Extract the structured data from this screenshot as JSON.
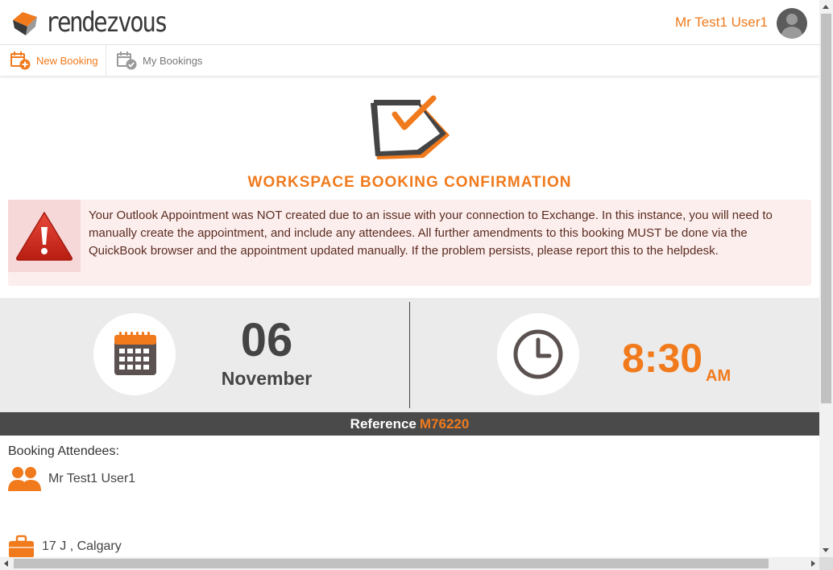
{
  "header": {
    "logo_text": "rendezvous",
    "user_name": "Mr Test1 User1",
    "avatar_icon": "user-avatar-icon"
  },
  "nav": {
    "new_booking": "New Booking",
    "my_bookings": "My Bookings"
  },
  "confirmation": {
    "title": "WORKSPACE BOOKING CONFIRMATION",
    "icon": "calendar-check-icon"
  },
  "alert": {
    "icon": "warning-icon",
    "message": "Your Outlook Appointment was NOT created due to an issue with your connection to Exchange. In this instance, you will need to manually create the appointment, and include any attendees. All further amendments to this booking MUST be done via the QuickBook browser and the appointment updated manually. If the problem persists, please report this to the helpdesk."
  },
  "booking": {
    "day": "06",
    "month": "November",
    "time": "8:30",
    "ampm": "AM",
    "reference_label": "Reference",
    "reference_code": "M76220"
  },
  "attendees": {
    "label": "Booking Attendees:",
    "people": [
      "Mr Test1 User1"
    ],
    "location": "17 J , Calgary"
  },
  "colors": {
    "accent": "#f07a1c",
    "alert_bg": "#fdeeee",
    "band_bg": "#ebebeb",
    "ref_bar": "#4a4a4a"
  }
}
